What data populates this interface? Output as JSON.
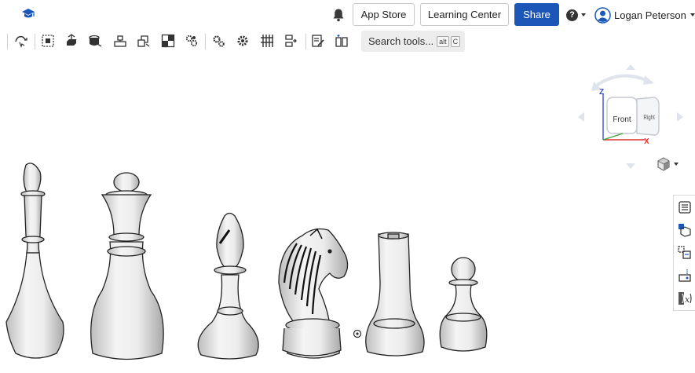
{
  "header": {
    "buttons": {
      "app_store": "App Store",
      "learning_center": "Learning Center",
      "share": "Share"
    },
    "user_name": "Logan Peterson"
  },
  "toolbar": {
    "search_label": "Search tools...",
    "shortcut_keys": [
      "alt",
      "C"
    ]
  },
  "viewcube": {
    "front_label": "Front",
    "right_label": "Right",
    "axis_z": "Z",
    "axis_x": "X"
  },
  "colors": {
    "accent": "#1c57b8",
    "axis_z": "#3a4fc4",
    "axis_x": "#d33",
    "axis_y": "#3fa33f"
  },
  "scene": {
    "pieces": [
      "king",
      "queen",
      "bishop",
      "knight",
      "rook",
      "pawn"
    ]
  }
}
